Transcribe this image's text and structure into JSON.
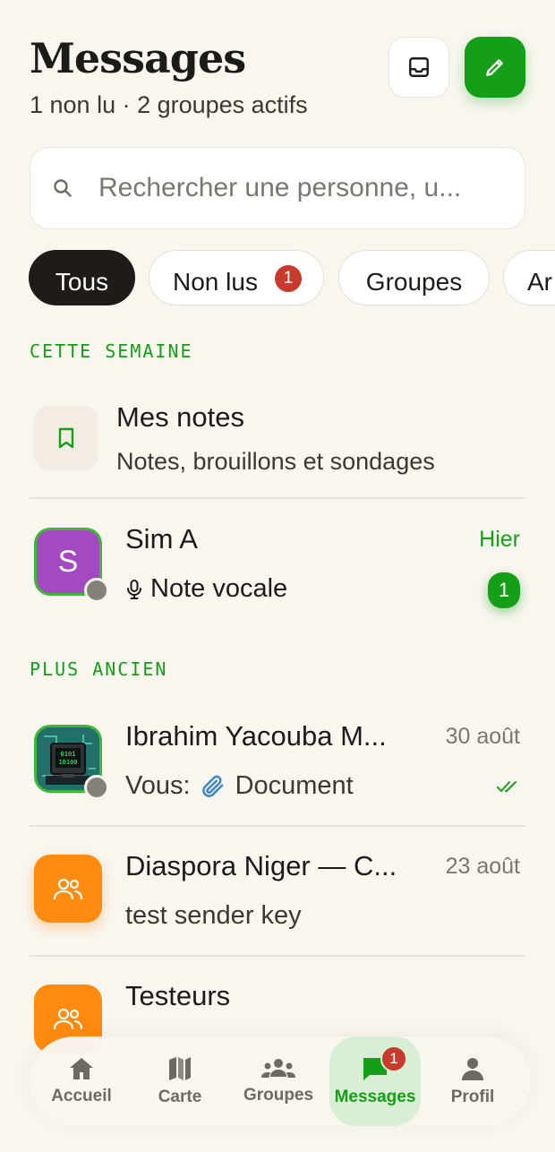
{
  "header": {
    "title": "Messages",
    "subtitle": "1 non lu · 2 groupes actifs",
    "inbox_icon": "inbox-icon",
    "compose_icon": "pencil-icon"
  },
  "search": {
    "placeholder": "Rechercher une personne, u..."
  },
  "filters": [
    {
      "label": "Tous",
      "active": true
    },
    {
      "label": "Non lus",
      "badge": "1"
    },
    {
      "label": "Groupes"
    },
    {
      "label": "Ar"
    }
  ],
  "sections": {
    "this_week": "CETTE SEMAINE",
    "older": "PLUS ANCIEN"
  },
  "notes": {
    "title": "Mes notes",
    "subtitle": "Notes, brouillons et sondages",
    "icon": "bookmark-icon"
  },
  "conversations": [
    {
      "name": "Sim A",
      "initial": "S",
      "time": "Hier",
      "preview": "Note vocale",
      "preview_icon": "microphone-icon",
      "unread": "1"
    },
    {
      "name": "Ibrahim Yacouba M...",
      "time": "30 août",
      "preview_prefix": "Vous:",
      "preview": "Document",
      "preview_icon": "paperclip-icon",
      "status_icon": "double-check-icon"
    },
    {
      "name": "Diaspora Niger — C...",
      "time": "23 août",
      "preview": "test sender key",
      "icon": "group-icon"
    },
    {
      "name": "Testeurs",
      "icon": "group-icon"
    }
  ],
  "nav": [
    {
      "label": "Accueil",
      "icon": "home-icon"
    },
    {
      "label": "Carte",
      "icon": "map-icon"
    },
    {
      "label": "Groupes",
      "icon": "people-icon"
    },
    {
      "label": "Messages",
      "icon": "chat-icon",
      "badge": "1",
      "active": true
    },
    {
      "label": "Profil",
      "icon": "person-icon"
    }
  ],
  "colors": {
    "accent": "#159e18",
    "background": "#f9f6f0",
    "badge_red": "#c83a2c",
    "group_orange": "#ff8c10",
    "avatar_purple": "#a349c1"
  }
}
